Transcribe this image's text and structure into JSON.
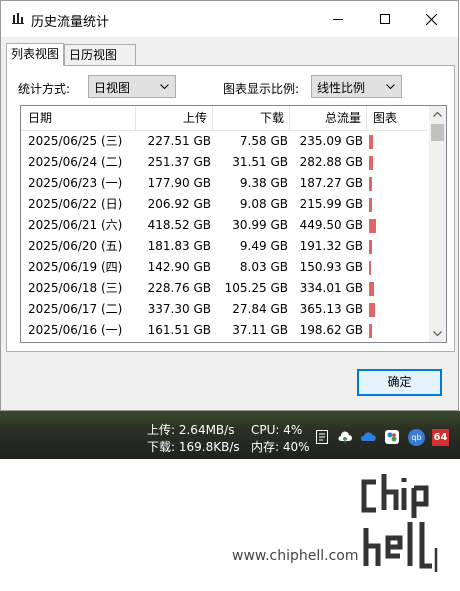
{
  "window": {
    "title": "历史流量统计"
  },
  "tabs": [
    {
      "label": "列表视图",
      "active": true
    },
    {
      "label": "日历视图",
      "active": false
    }
  ],
  "controls": {
    "stat_mode_label": "统计方式:",
    "stat_mode_value": "日视图",
    "chart_scale_label": "图表显示比例:",
    "chart_scale_value": "线性比例"
  },
  "table": {
    "headers": {
      "date": "日期",
      "upload": "上传",
      "download": "下载",
      "total": "总流量",
      "chart": "图表"
    },
    "rows": [
      {
        "date": "2025/06/25 (三)",
        "upload": "227.51 GB",
        "download": "7.58 GB",
        "total": "235.09 GB",
        "total_gb": 235.09
      },
      {
        "date": "2025/06/24 (二)",
        "upload": "251.37 GB",
        "download": "31.51 GB",
        "total": "282.88 GB",
        "total_gb": 282.88
      },
      {
        "date": "2025/06/23 (一)",
        "upload": "177.90 GB",
        "download": "9.38 GB",
        "total": "187.27 GB",
        "total_gb": 187.27
      },
      {
        "date": "2025/06/22 (日)",
        "upload": "206.92 GB",
        "download": "9.08 GB",
        "total": "215.99 GB",
        "total_gb": 215.99
      },
      {
        "date": "2025/06/21 (六)",
        "upload": "418.52 GB",
        "download": "30.99 GB",
        "total": "449.50 GB",
        "total_gb": 449.5
      },
      {
        "date": "2025/06/20 (五)",
        "upload": "181.83 GB",
        "download": "9.49 GB",
        "total": "191.32 GB",
        "total_gb": 191.32
      },
      {
        "date": "2025/06/19 (四)",
        "upload": "142.90 GB",
        "download": "8.03 GB",
        "total": "150.93 GB",
        "total_gb": 150.93
      },
      {
        "date": "2025/06/18 (三)",
        "upload": "228.76 GB",
        "download": "105.25 GB",
        "total": "334.01 GB",
        "total_gb": 334.01
      },
      {
        "date": "2025/06/17 (二)",
        "upload": "337.30 GB",
        "download": "27.84 GB",
        "total": "365.13 GB",
        "total_gb": 365.13
      },
      {
        "date": "2025/06/16 (一)",
        "upload": "161.51 GB",
        "download": "37.11 GB",
        "total": "198.62 GB",
        "total_gb": 198.62
      }
    ],
    "bar_color": "#e06666"
  },
  "buttons": {
    "ok": "确定"
  },
  "taskbar": {
    "upload_speed": "上传: 2.64MB/s",
    "download_speed": "下载: 169.8KB/s",
    "cpu": "CPU: 4%",
    "memory": "内存: 40%",
    "tray_icons": [
      "notes-icon",
      "cloud-upload-icon",
      "cloud-icon",
      "app-icon",
      "qbittorrent-icon",
      "badge-64-icon"
    ],
    "badge_text": "64",
    "qb_text": "qb"
  },
  "watermark": {
    "url": "www.chiphell.com",
    "logo_text": "chip hell"
  }
}
